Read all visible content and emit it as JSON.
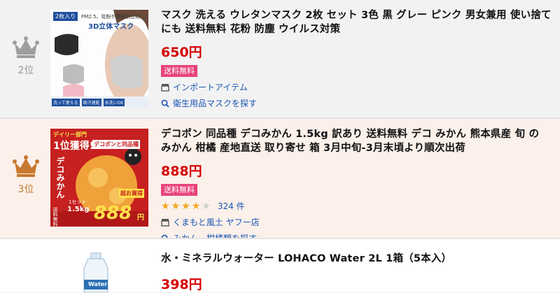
{
  "items": [
    {
      "rank": "2位",
      "title": "マスク 洗える ウレタンマスク 2枚 セット 3色 黒 グレー ピンク 男女兼用 使い捨て にも 送料無料 花粉 防塵 ウイルス対策",
      "price": "650円",
      "badge": "送料無料",
      "store": "インポートアイテム",
      "search": "衛生用品マスクを探す",
      "thumb": {
        "tag": "2枚入り",
        "headline": "PM2.5、花粉や風邪防止に",
        "title": "3D立体マスク",
        "chips": [
          "洗って使える",
          "吸汗速乾",
          "水洗いOK"
        ]
      }
    },
    {
      "rank": "3位",
      "title": "デコポン 同品種 デコみかん 1.5kg 訳あり 送料無料 デコ みかん 熊本県産 旬 の みかん 柑橘 産地直送 取り寄せ 箱 3月中旬-3月末頃より順次出荷",
      "price": "888円",
      "badge": "送料無料",
      "rating": 4,
      "review_count": "324 件",
      "store": "くまもと風土 ヤフー店",
      "search": "みかん、柑橘類を探す",
      "thumb": {
        "banner": "デイリー部門",
        "first": "1位獲得!",
        "sub": "デコポンと同品種",
        "name": "デコみかん",
        "weight_a": "1セット",
        "weight_b": "1.5kg",
        "shipping": "送料無料",
        "deal": "超お買得",
        "big_price": "888",
        "yen": "円"
      }
    },
    {
      "title": "水・ミネラルウォーター LOHACO Water 2L 1箱（5本入）",
      "price": "398円",
      "thumb": {
        "label": "Water"
      }
    }
  ],
  "colors": {
    "price": "#d60000",
    "badge": "#e8437a",
    "link": "#1a55b4",
    "silver_crown": "#9e9e9e",
    "bronze_crown": "#c8782e"
  }
}
